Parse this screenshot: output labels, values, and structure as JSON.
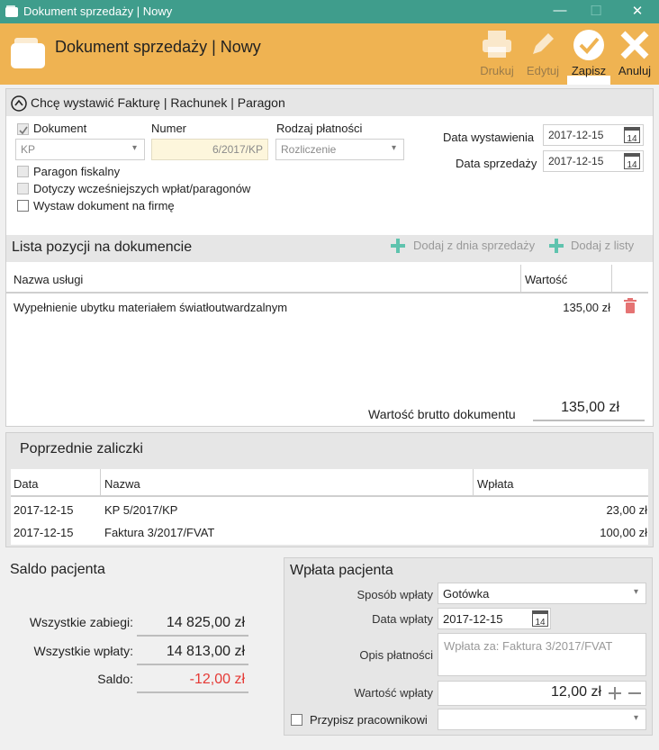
{
  "window": {
    "title": "Dokument sprzedaży | Nowy",
    "controls": [
      "—",
      "☐",
      "✕"
    ]
  },
  "header": {
    "title": "Dokument sprzedaży | Nowy",
    "buttons": [
      {
        "label": "Drukuj",
        "enabled": false,
        "icon": "printer-icon"
      },
      {
        "label": "Edytuj",
        "enabled": false,
        "icon": "pencil-icon"
      },
      {
        "label": "Zapisz",
        "enabled": true,
        "icon": "check-icon"
      },
      {
        "label": "Anuluj",
        "enabled": true,
        "icon": "close-icon"
      }
    ]
  },
  "doc_type": {
    "toggle_label": "Chcę wystawić Fakturę | Rachunek | Paragon"
  },
  "form": {
    "dokument_label": "Dokument",
    "dokument_checked": true,
    "dokument_value": "KP",
    "numer_label": "Numer",
    "numer_value": "6/2017/KP",
    "platnosc_label": "Rodzaj płatności",
    "platnosc_value": "Rozliczenie",
    "paragon_fiskalny": "Paragon fiskalny",
    "dotyczy": "Dotyczy wcześniejszych wpłat/paragonów",
    "wystaw_firme": "Wystaw dokument na firmę",
    "data_wystawienia_label": "Data wystawienia",
    "data_wystawienia": "2017-12-15",
    "data_sprzedazy_label": "Data sprzedaży",
    "data_sprzedazy": "2017-12-15",
    "calendar_day": "14"
  },
  "positions": {
    "title": "Lista pozycji na dokumencie",
    "add_from_day": "Dodaj z dnia sprzedaży",
    "add_from_list": "Dodaj z listy",
    "columns": [
      "Nazwa usługi",
      "Wartość"
    ],
    "rows": [
      {
        "name": "Wypełnienie ubytku materiałem światłoutwardzalnym",
        "value": "135,00 zł"
      }
    ],
    "total_label": "Wartość brutto dokumentu",
    "total_value": "135,00 zł"
  },
  "advances": {
    "title": "Poprzednie zaliczki",
    "columns": [
      "Data",
      "Nazwa",
      "Wpłata"
    ],
    "rows": [
      {
        "date": "2017-12-15",
        "name": "KP 5/2017/KP",
        "amount": "23,00 zł"
      },
      {
        "date": "2017-12-15",
        "name": "Faktura 3/2017/FVAT",
        "amount": "100,00 zł"
      }
    ]
  },
  "balance": {
    "title": "Saldo pacjenta",
    "zabiegi_label": "Wszystkie zabiegi:",
    "zabiegi_value": "14 825,00 zł",
    "wplaty_label": "Wszystkie wpłaty:",
    "wplaty_value": "14 813,00 zł",
    "saldo_label": "Saldo:",
    "saldo_value": "-12,00 zł"
  },
  "payment": {
    "title": "Wpłata pacjenta",
    "sposob_label": "Sposób wpłaty",
    "sposob_value": "Gotówka",
    "data_label": "Data wpłaty",
    "data_value": "2017-12-15",
    "opis_label": "Opis płatności",
    "opis_placeholder": "Wpłata za: Faktura 3/2017/FVAT",
    "wartosc_label": "Wartość wpłaty",
    "wartosc_value": "12,00 zł",
    "przypisz_label": "Przypisz pracownikowi"
  },
  "colors": {
    "titlebar": "#3f9d8c",
    "header": "#efb352",
    "accent_green": "#5fc3ae",
    "negative": "#e53935",
    "delete": "#e57373"
  }
}
